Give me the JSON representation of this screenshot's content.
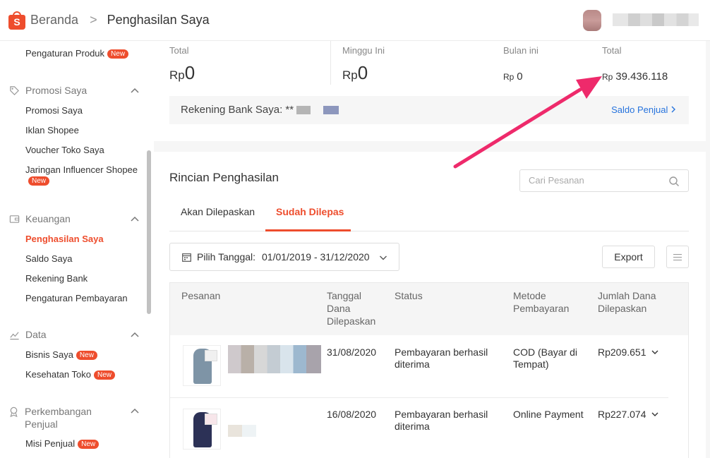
{
  "header": {
    "logo_letter": "S",
    "breadcrumb_home": "Beranda",
    "breadcrumb_separator": ">",
    "breadcrumb_current": "Penghasilan Saya"
  },
  "sidebar": {
    "items": [
      {
        "label": "Pengaturan Produk",
        "badge": "New"
      },
      {
        "section": "Promosi Saya",
        "icon": "tag-icon"
      },
      {
        "label": "Promosi Saya"
      },
      {
        "label": "Iklan Shopee"
      },
      {
        "label": "Voucher Toko Saya"
      },
      {
        "label": "Jaringan Influencer Shopee",
        "badge": "New"
      },
      {
        "section": "Keuangan",
        "icon": "wallet-icon"
      },
      {
        "label": "Penghasilan Saya",
        "active": true
      },
      {
        "label": "Saldo Saya"
      },
      {
        "label": "Rekening Bank"
      },
      {
        "label": "Pengaturan Pembayaran"
      },
      {
        "section": "Data",
        "icon": "chart-line-icon"
      },
      {
        "label": "Bisnis Saya",
        "badge": "New"
      },
      {
        "label": "Kesehatan Toko",
        "badge": "New"
      },
      {
        "section": "Perkembangan Penjual",
        "icon": "medal-icon"
      },
      {
        "label": "Misi Penjual",
        "badge": "New"
      }
    ]
  },
  "summary": {
    "pending_total_label": "Total",
    "pending_total_currency": "Rp",
    "pending_total_value": "0",
    "week_label": "Minggu Ini",
    "week_currency": "Rp",
    "week_value": "0",
    "month_label": "Bulan ini",
    "month_currency": "Rp",
    "month_value": "0",
    "released_total_label": "Total",
    "released_total_currency": "Rp",
    "released_total_value": "39.436.118",
    "bank_label": "Rekening Bank Saya: **",
    "saldo_link": "Saldo Penjual"
  },
  "details": {
    "title": "Rincian Penghasilan",
    "search_placeholder": "Cari Pesanan",
    "tabs": [
      "Akan Dilepaskan",
      "Sudah Dilepas"
    ],
    "active_tab": 1,
    "date_label": "Pilih Tanggal:",
    "date_value": "01/01/2019 - 31/12/2020",
    "export_label": "Export",
    "columns": [
      "Pesanan",
      "Tanggal Dana Dilepaskan",
      "Status",
      "Metode Pembayaran",
      "Jumlah Dana Dilepaskan"
    ],
    "rows": [
      {
        "date": "31/08/2020",
        "status": "Pembayaran berhasil diterima",
        "method": "COD (Bayar di Tempat)",
        "amount": "Rp209.651"
      },
      {
        "date": "16/08/2020",
        "status": "Pembayaran berhasil diterima",
        "method": "Online Payment",
        "amount": "Rp227.074"
      }
    ]
  },
  "colors": {
    "brand": "#ee4d2d",
    "link": "#2673dd",
    "annotation_arrow": "#ee2a6b"
  }
}
